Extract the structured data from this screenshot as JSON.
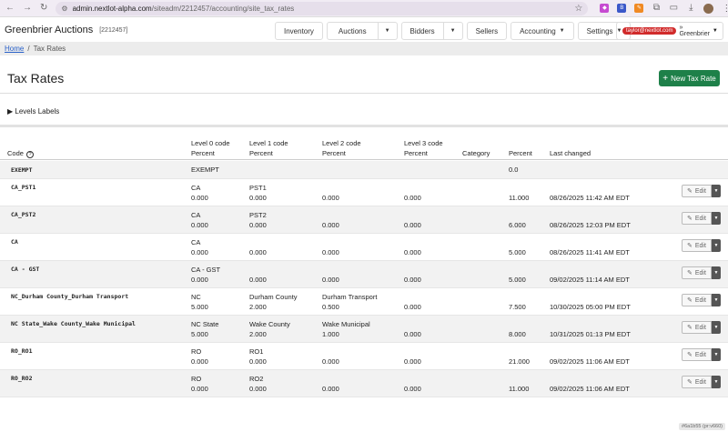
{
  "browser": {
    "url_host": "admin.nextlot-alpha.com",
    "url_path": "/siteadm/2212457/accounting/site_tax_rates"
  },
  "app": {
    "brand": "Greenbrier Auctions",
    "site_id": "[2212457]",
    "nav": {
      "inventory": "Inventory",
      "auctions": "Auctions",
      "bidders": "Bidders",
      "sellers": "Sellers",
      "accounting": "Accounting",
      "settings": "Settings"
    },
    "user": {
      "email": "taylor@nextlot.com",
      "site": "» Greenbrier"
    }
  },
  "breadcrumb": {
    "home": "Home",
    "separator": "/",
    "current": "Tax Rates"
  },
  "page": {
    "title": "Tax Rates",
    "new_button": "New Tax Rate",
    "levels_toggle": "▶ Levels Labels"
  },
  "table": {
    "headers": {
      "code": "Code",
      "level0_a": "Level 0 code",
      "level0_b": "Percent",
      "level1_a": "Level 1 code",
      "level1_b": "Percent",
      "level2_a": "Level 2 code",
      "level2_b": "Percent",
      "level3_a": "Level 3 code",
      "level3_b": "Percent",
      "category": "Category",
      "percent": "Percent",
      "last_changed": "Last changed"
    },
    "edit_label": "Edit",
    "rows": [
      {
        "code": "EXEMPT",
        "l0c": "EXEMPT",
        "l0p": "",
        "l1c": "",
        "l1p": "",
        "l2c": "",
        "l2p": "",
        "l3c": "",
        "l3p": "",
        "percent": "0.0",
        "changed": ""
      },
      {
        "code": "CA_PST1",
        "l0c": "CA",
        "l0p": "0.000",
        "l1c": "PST1",
        "l1p": "0.000",
        "l2c": "",
        "l2p": "0.000",
        "l3c": "",
        "l3p": "0.000",
        "percent": "11.000",
        "changed": "08/26/2025 11:42 AM EDT"
      },
      {
        "code": "CA_PST2",
        "l0c": "CA",
        "l0p": "0.000",
        "l1c": "PST2",
        "l1p": "0.000",
        "l2c": "",
        "l2p": "0.000",
        "l3c": "",
        "l3p": "0.000",
        "percent": "6.000",
        "changed": "08/26/2025 12:03 PM EDT"
      },
      {
        "code": "CA",
        "l0c": "CA",
        "l0p": "0.000",
        "l1c": "",
        "l1p": "0.000",
        "l2c": "",
        "l2p": "0.000",
        "l3c": "",
        "l3p": "0.000",
        "percent": "5.000",
        "changed": "08/26/2025 11:41 AM EDT"
      },
      {
        "code": "CA - GST",
        "l0c": "CA - GST",
        "l0p": "0.000",
        "l1c": "",
        "l1p": "0.000",
        "l2c": "",
        "l2p": "0.000",
        "l3c": "",
        "l3p": "0.000",
        "percent": "5.000",
        "changed": "09/02/2025 11:14 AM EDT"
      },
      {
        "code": "NC_Durham County_Durham Transport",
        "l0c": "NC",
        "l0p": "5.000",
        "l1c": "Durham County",
        "l1p": "2.000",
        "l2c": "Durham Transport",
        "l2p": "0.500",
        "l3c": "",
        "l3p": "0.000",
        "percent": "7.500",
        "changed": "10/30/2025 05:00 PM EDT"
      },
      {
        "code": "NC State_Wake County_Wake Municipal",
        "l0c": "NC State",
        "l0p": "5.000",
        "l1c": "Wake County",
        "l1p": "2.000",
        "l2c": "Wake Municipal",
        "l2p": "1.000",
        "l3c": "",
        "l3p": "0.000",
        "percent": "8.000",
        "changed": "10/31/2025 01:13 PM EDT"
      },
      {
        "code": "RO_RO1",
        "l0c": "RO",
        "l0p": "0.000",
        "l1c": "RO1",
        "l1p": "0.000",
        "l2c": "",
        "l2p": "0.000",
        "l3c": "",
        "l3p": "0.000",
        "percent": "21.000",
        "changed": "09/02/2025 11:06 AM EDT"
      },
      {
        "code": "RO_RO2",
        "l0c": "RO",
        "l0p": "0.000",
        "l1c": "RO2",
        "l1p": "0.000",
        "l2c": "",
        "l2p": "0.000",
        "l3c": "",
        "l3p": "0.000",
        "percent": "11.000",
        "changed": "09/02/2025 11:06 AM EDT"
      }
    ]
  },
  "footer_tag": "#6a1b55 (pr:v660)"
}
